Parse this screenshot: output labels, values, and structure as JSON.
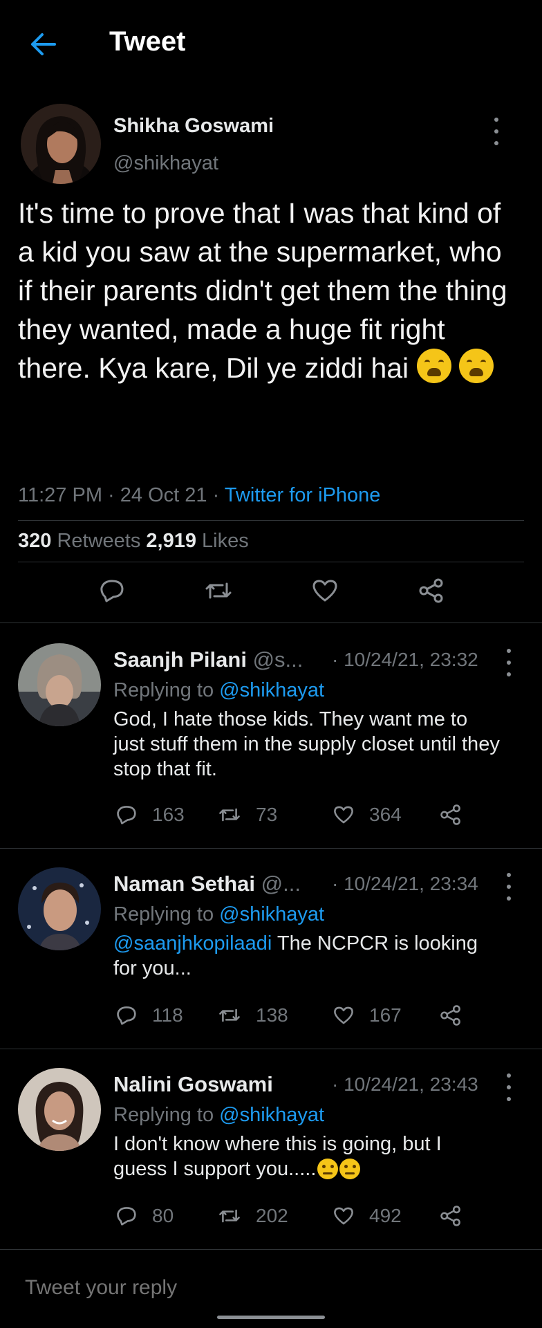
{
  "header": {
    "title": "Tweet"
  },
  "main_tweet": {
    "author_name": "Shikha Goswami",
    "author_handle": "@shikhayat",
    "text": "It's time to prove that I was that kind of a kid you saw at the supermarket, who if their parents didn't get them the thing they wanted, made a huge fit right there. Kya kare, Dil ye ziddi hai",
    "emoji": [
      "weary-face",
      "weary-face"
    ],
    "time": "11:27 PM",
    "date": "24 Oct 21",
    "source": "Twitter for iPhone",
    "retweets_count": "320",
    "retweets_label": "Retweets",
    "likes_count": "2,919",
    "likes_label": "Likes"
  },
  "replies": [
    {
      "name": "Saanjh Pilani",
      "handle": "@s...",
      "time": "· 10/24/21, 23:32",
      "replying_prefix": "Replying to ",
      "replying_to": "@shikhayat",
      "mention": "",
      "text": "God, I hate those kids. They want me to just stuff them in the supply closet until they stop that fit.",
      "reply_count": "163",
      "retweet_count": "73",
      "like_count": "364"
    },
    {
      "name": "Naman Sethai",
      "handle": "@...",
      "time": "· 10/24/21, 23:34",
      "replying_prefix": "Replying to ",
      "replying_to": "@shikhayat",
      "mention": "@saanjhkopilaadi",
      "text": " The NCPCR is looking for you...",
      "reply_count": "118",
      "retweet_count": "138",
      "like_count": "167"
    },
    {
      "name": "Nalini Goswami",
      "handle": "",
      "time": "· 10/24/21, 23:43",
      "replying_prefix": "Replying to ",
      "replying_to": "@shikhayat",
      "mention": "",
      "text": "I don't know where this is going, but I guess I support you.....",
      "reply_count": "80",
      "retweet_count": "202",
      "like_count": "492"
    }
  ],
  "compose": {
    "placeholder": "Tweet your reply"
  },
  "colors": {
    "accent": "#1d9bf0",
    "background": "#000000",
    "muted": "#71767b",
    "divider": "#2f3336"
  }
}
